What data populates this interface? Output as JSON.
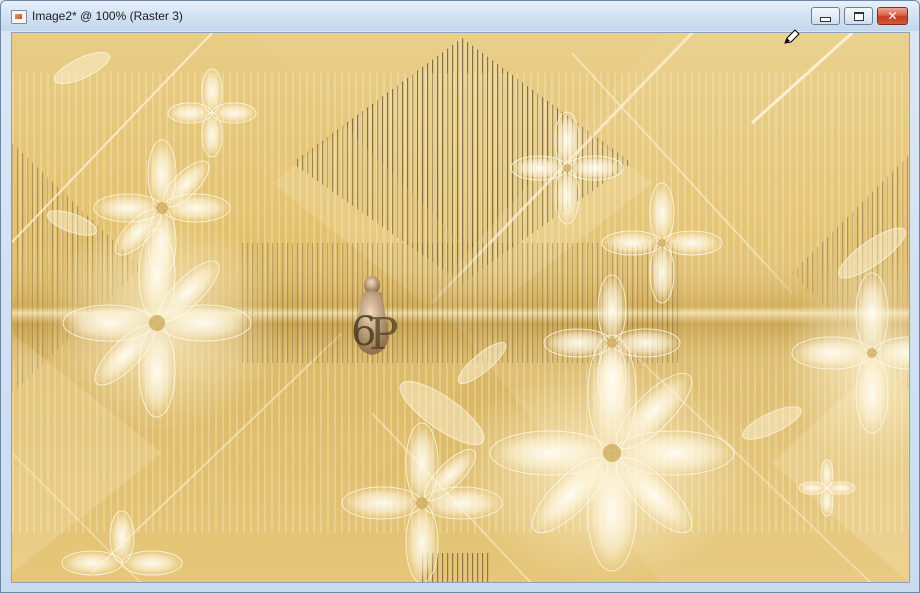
{
  "window": {
    "title": "Image2* @ 100% (Raster 3)",
    "buttons": {
      "minimize_icon": "minimize-icon",
      "maximize_icon": "restore-icon",
      "close_icon": "close-icon",
      "close_glyph": "✕"
    }
  },
  "canvas": {
    "artwork": "golden abstract background with white flowers and woman figure with watermark",
    "colors": {
      "base": "#e2c06b",
      "light": "#f6ecc8",
      "dark": "#5a4416",
      "flower": "#fffaf0"
    }
  }
}
